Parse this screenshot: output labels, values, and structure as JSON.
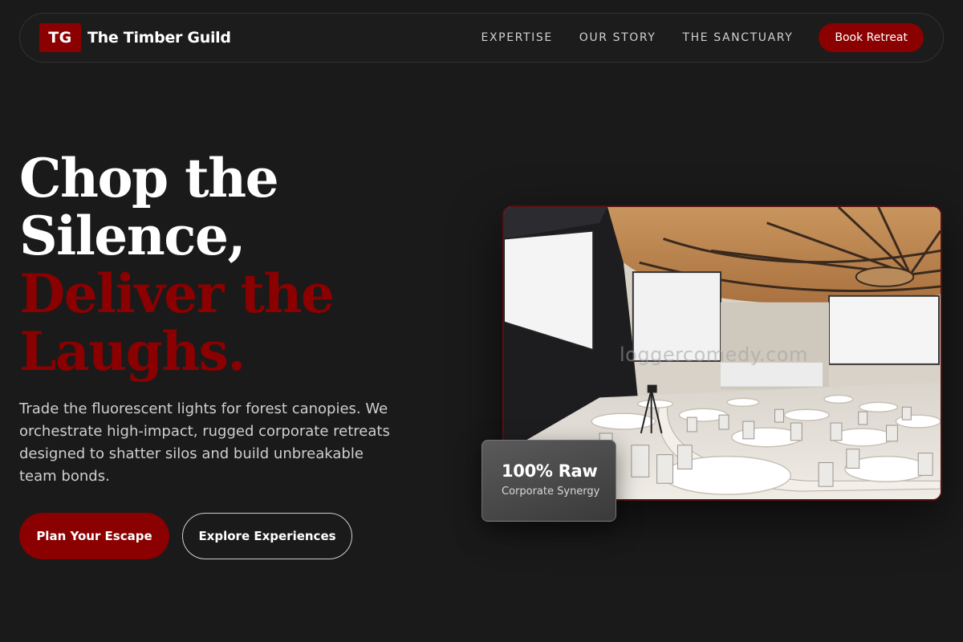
{
  "brand": {
    "mark": "TG",
    "name": "The Timber Guild"
  },
  "nav": {
    "links": [
      "EXPERTISE",
      "OUR STORY",
      "THE SANCTUARY"
    ],
    "cta": "Book Retreat"
  },
  "hero": {
    "headline_white": [
      "Chop the",
      "Silence,"
    ],
    "headline_red": [
      "Deliver the",
      "Laughs."
    ],
    "subtext": "Trade the fluorescent lights for forest canopies. We orchestrate high-impact, rugged corporate retreats designed to shatter silos and build unbreakable team bonds.",
    "primary_cta": "Plan Your Escape",
    "secondary_cta": "Explore Experiences"
  },
  "image": {
    "watermark": "loggercomedy.com",
    "icon": "conference-hall-photo"
  },
  "stat_card": {
    "value": "100% Raw",
    "label": "Corporate Synergy"
  },
  "colors": {
    "background": "#1a1a1a",
    "accent": "#8b0000",
    "text": "#ffffff",
    "muted": "#cfcfcf"
  }
}
